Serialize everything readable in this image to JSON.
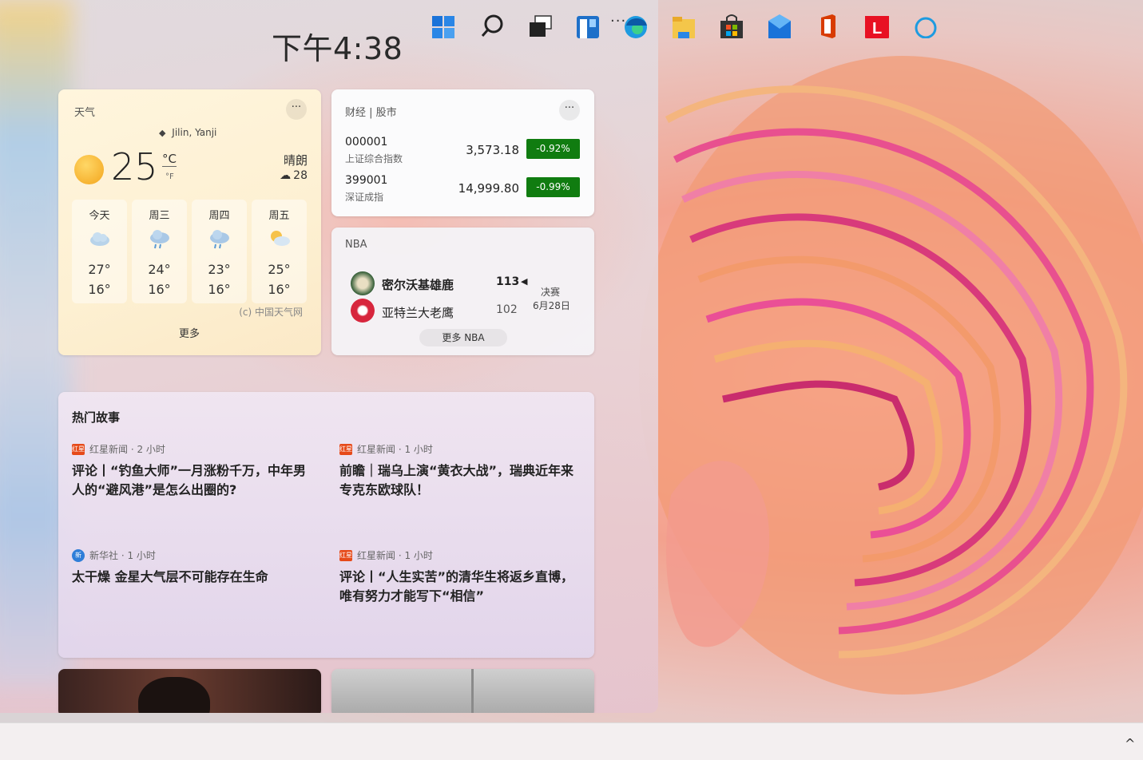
{
  "panel": {
    "clock": "下午4:38",
    "menu_label": "···"
  },
  "weather": {
    "title": "天气",
    "menu_label": "···",
    "location": "Jilin, Yanji",
    "temperature": "25",
    "unit_c": "°C",
    "unit_f": "°F",
    "condition": "晴朗",
    "aqi": "28",
    "aqi_label": "ᯤ",
    "forecast": [
      {
        "day": "今天",
        "hi": "27°",
        "lo": "16°",
        "icon": "cloud-icon"
      },
      {
        "day": "周三",
        "hi": "24°",
        "lo": "16°",
        "icon": "rain-cloud-icon"
      },
      {
        "day": "周四",
        "hi": "23°",
        "lo": "16°",
        "icon": "rain-cloud-icon"
      },
      {
        "day": "周五",
        "hi": "25°",
        "lo": "16°",
        "icon": "partly-sunny-icon"
      }
    ],
    "source": "(c) 中国天气网",
    "more": "更多"
  },
  "stocks": {
    "title": "财经 | 股市",
    "menu_label": "···",
    "items": [
      {
        "code": "000001",
        "name": "上证综合指数",
        "price": "3,573.18",
        "change": "-0.92%"
      },
      {
        "code": "399001",
        "name": "深证成指",
        "price": "14,999.80",
        "change": "-0.99%"
      }
    ],
    "change_color": "#107c10"
  },
  "nba": {
    "title": "NBA",
    "teams": [
      {
        "name": "密尔沃基雄鹿",
        "score": "113",
        "winner": true
      },
      {
        "name": "亚特兰大老鹰",
        "score": "102",
        "winner": false
      }
    ],
    "round": "决赛",
    "date": "6月28日",
    "more": "更多 NBA"
  },
  "stories": {
    "title": "热门故事",
    "items": [
      {
        "source": "红星新闻 · 2 小时",
        "title": "评论丨“钓鱼大师”一月涨粉千万，中年男人的“避风港”是怎么出圈的?",
        "icon": "红星"
      },
      {
        "source": "红星新闻 · 1 小时",
        "title": "前瞻｜瑞乌上演“黄衣大战”，瑞典近年来专克东欧球队！",
        "icon": "红星"
      },
      {
        "source": "新华社 · 1 小时",
        "title": "太干燥 金星大气层不可能存在生命",
        "icon": "新"
      },
      {
        "source": "红星新闻 · 1 小时",
        "title": "评论丨“人生实苦”的清华生将返乡直博，唯有努力才能写下“相信”",
        "icon": "红星"
      }
    ]
  },
  "taskbar": {
    "icons": [
      "start-icon",
      "search-icon",
      "task-view-icon",
      "widgets-icon",
      "edge-icon",
      "file-explorer-icon",
      "store-icon",
      "mail-icon",
      "office-icon",
      "app-l-icon",
      "cortana-icon"
    ],
    "tray": "^"
  }
}
